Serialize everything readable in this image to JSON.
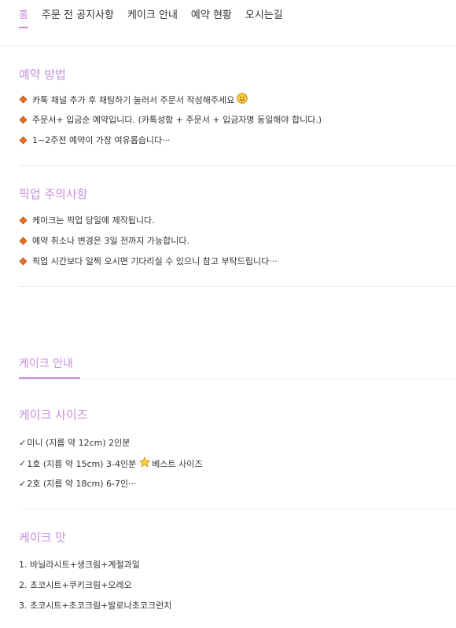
{
  "nav": {
    "items": [
      "홈",
      "주문 전 공지사항",
      "케이크 안내",
      "예약 현황",
      "오시는길"
    ]
  },
  "reservation": {
    "title": "예약 방법",
    "lines": [
      "카톡 채널 추가 후 채팅하기 눌러서 주문서 작성해주세요",
      "주문서+ 입금순 예약입니다. (카톡성함 + 주문서 + 입금자명 동일해야 합니다.)",
      "1~2주전 예약이 가장 여유롭습니다···"
    ]
  },
  "pickup": {
    "title": "픽업 주의사항",
    "lines": [
      "케이크는 픽업 당일에 제작됩니다.",
      "예약 취소나 변경은 3일 전까지 가능합니다.",
      "픽업 시간보다 일찍 오시면 기다리실 수 있으니 참고 부탁드립니다···"
    ]
  },
  "cake_guide": {
    "tab_title": "케이크 안내"
  },
  "sizes": {
    "title": "케이크 사이즈",
    "lines": [
      "미니 (지름 약 12cm) 2인분",
      "1호 (지름 약 15cm) 3-4인분",
      "2호 (지름 약 18cm) 6-7인···"
    ],
    "best_label": "베스트 사이즈",
    "check_mark": "✓"
  },
  "flavors": {
    "title": "케이크 맛",
    "lines": [
      "1. 바닐라시트+생크림+계절과일",
      "2. 초코시트+쿠키크림+오레오",
      "3. 초코시트+초코크림+발로나초코크런치"
    ]
  },
  "colors": {
    "accent": "#c58fdc",
    "bullet": "#e9721f",
    "text": "#333333"
  },
  "icons": [
    "diamond-bullet-icon",
    "smiley-icon",
    "star-icon"
  ]
}
